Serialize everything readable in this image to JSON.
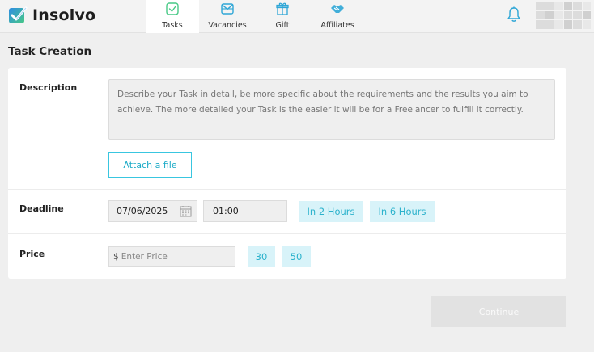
{
  "app": {
    "name": "Insolvo"
  },
  "nav": {
    "tasks": "Tasks",
    "vacancies": "Vacancies",
    "gift": "Gift",
    "affiliates": "Affiliates"
  },
  "page": {
    "title": "Task Creation"
  },
  "description": {
    "label": "Description",
    "placeholder": "Describe your Task in detail, be more specific about the requirements and the results you aim to achieve. The more detailed your Task is the easier it will be for a Freelancer to fulfill it correctly.",
    "attach_label": "Attach a file"
  },
  "deadline": {
    "label": "Deadline",
    "date": "07/06/2025",
    "time": "01:00",
    "quick_2h": "In 2 Hours",
    "quick_6h": "In 6 Hours"
  },
  "price": {
    "label": "Price",
    "currency": "$",
    "placeholder": "Enter Price",
    "quick_30": "30",
    "quick_50": "50"
  },
  "actions": {
    "continue_label": "Continue"
  },
  "colors": {
    "accent": "#39c6e0",
    "chip_bg": "#d8f3f9",
    "logo_blue": "#2f8de4",
    "logo_green": "#47c985"
  },
  "icons": {
    "logo": "checkbox-logo-icon",
    "tasks": "checkbox-icon",
    "vacancies": "envelope-icon",
    "gift": "gift-icon",
    "affiliates": "handshake-icon",
    "bell": "bell-icon",
    "calendar": "calendar-icon"
  }
}
